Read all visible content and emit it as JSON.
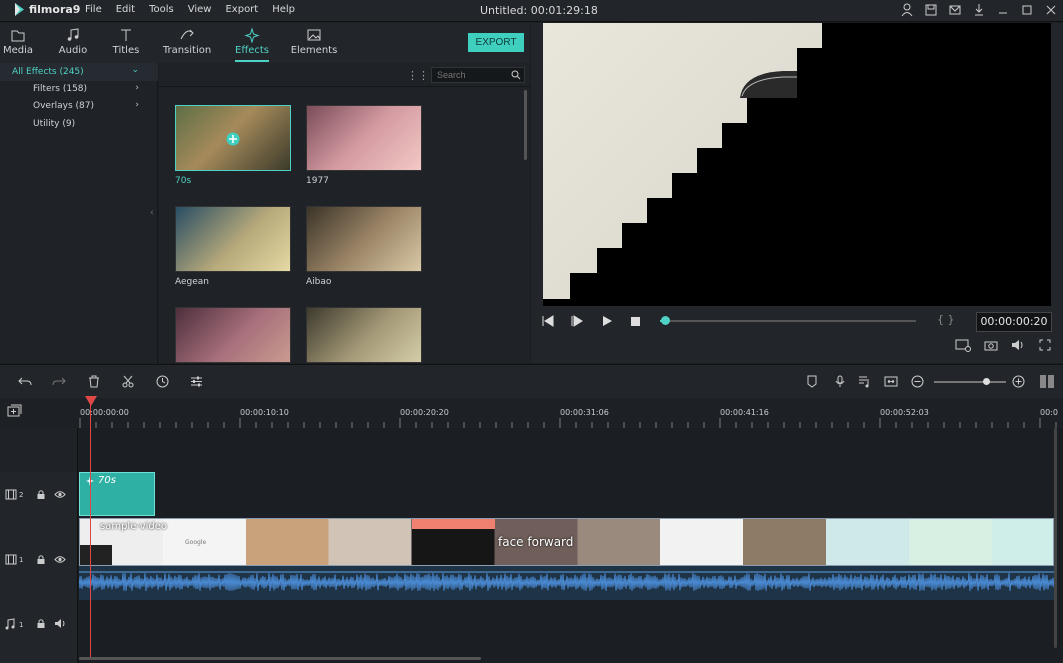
{
  "app": {
    "name": "filmora9",
    "title": "Untitled:",
    "duration": "00:01:29:18"
  },
  "menu": [
    "File",
    "Edit",
    "Tools",
    "View",
    "Export",
    "Help"
  ],
  "tabs": [
    {
      "label": "Media"
    },
    {
      "label": "Audio"
    },
    {
      "label": "Titles"
    },
    {
      "label": "Transition"
    },
    {
      "label": "Effects"
    },
    {
      "label": "Elements"
    }
  ],
  "export_label": "EXPORT",
  "categories": [
    {
      "label": "All Effects (245)"
    },
    {
      "label": "Filters (158)"
    },
    {
      "label": "Overlays (87)"
    },
    {
      "label": "Utility (9)"
    }
  ],
  "search": {
    "placeholder": "Search"
  },
  "effects": [
    {
      "name": "70s"
    },
    {
      "name": "1977"
    },
    {
      "name": "Aegean"
    },
    {
      "name": "Aibao"
    },
    {
      "name": ""
    },
    {
      "name": ""
    }
  ],
  "preview": {
    "timecode": "00:00:00:20",
    "brackets": "{ }",
    "playback_progress": 0.02
  },
  "ruler": [
    "00:00:00:00",
    "00:00:10:10",
    "00:00:20:20",
    "00:00:31:06",
    "00:00:41:16",
    "00:00:52:03",
    "00:0"
  ],
  "tracks": {
    "fx": {
      "number": "2",
      "clip_label": "70s"
    },
    "video": {
      "number": "1",
      "clip_label": "sample-video",
      "overlay_texts": [
        "Google",
        "face forward"
      ]
    },
    "audio": {
      "number": "1"
    }
  },
  "zoom_level": 0.72,
  "colors": {
    "accent": "#4fd1c5",
    "playhead": "#e04848",
    "audio_wave": "#4a8bd4"
  }
}
